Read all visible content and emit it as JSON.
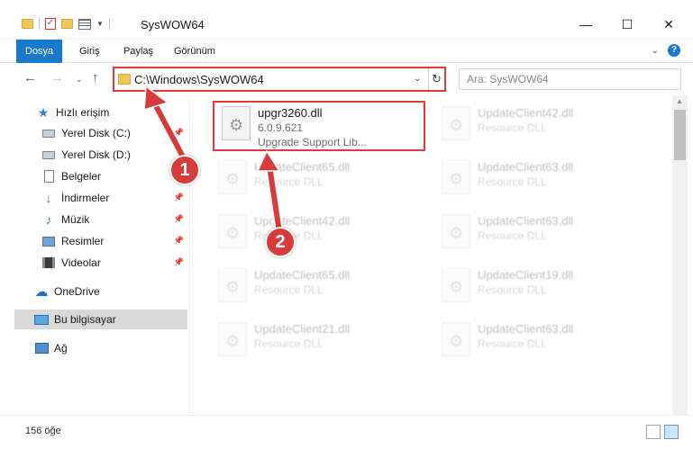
{
  "window": {
    "title": "SysWOW64",
    "minimize": "—",
    "maximize": "☐",
    "close": "✕"
  },
  "ribbon": {
    "tabs": [
      {
        "label": "Dosya",
        "active": true
      },
      {
        "label": "Giriş",
        "active": false
      },
      {
        "label": "Paylaş",
        "active": false
      },
      {
        "label": "Görünüm",
        "active": false
      }
    ]
  },
  "address": {
    "path": "C:\\Windows\\SysWOW64",
    "search_placeholder": "Ara: SysWOW64"
  },
  "sidebar": {
    "items": [
      {
        "label": "Hızlı erişim",
        "icon": "star-icon",
        "pinned": false
      },
      {
        "label": "Yerel Disk (C:)",
        "icon": "drive-icon",
        "pinned": true
      },
      {
        "label": "Yerel Disk (D:)",
        "icon": "drive-icon",
        "pinned": false
      },
      {
        "label": "Belgeler",
        "icon": "document-icon",
        "pinned": true
      },
      {
        "label": "İndirmeler",
        "icon": "download-icon",
        "pinned": true
      },
      {
        "label": "Müzik",
        "icon": "music-icon",
        "pinned": true
      },
      {
        "label": "Resimler",
        "icon": "pictures-icon",
        "pinned": true
      },
      {
        "label": "Videolar",
        "icon": "video-icon",
        "pinned": true
      },
      {
        "label": "OneDrive",
        "icon": "cloud-icon",
        "pinned": false
      },
      {
        "label": "Bu bilgisayar",
        "icon": "computer-icon",
        "pinned": false,
        "selected": true
      },
      {
        "label": "Ağ",
        "icon": "network-icon",
        "pinned": false
      }
    ]
  },
  "files": {
    "highlighted": {
      "name": "upgr3260.dll",
      "version": "6.0.9.621",
      "description": "Upgrade Support Lib..."
    },
    "faded": [
      {
        "name": "UpdateClient42.dll",
        "type": "Resource DLL"
      },
      {
        "name": "UpdateClient65.dll",
        "type": "Resource DLL"
      },
      {
        "name": "UpdateClient63.dll",
        "type": "Resource DLL"
      },
      {
        "name": "UpdateClient42.dll",
        "type": "Resource DLL"
      },
      {
        "name": "UpdateClient63.dll",
        "type": "Resource DLL"
      },
      {
        "name": "UpdateClient65.dll",
        "type": "Resource DLL"
      },
      {
        "name": "UpdateClient19.dll",
        "type": "Resource DLL"
      },
      {
        "name": "UpdateClient21.dll",
        "type": "Resource DLL"
      },
      {
        "name": "UpdateClient63.dll",
        "type": "Resource DLL"
      }
    ]
  },
  "status": {
    "item_count": "156 öğe"
  },
  "callouts": {
    "one": "1",
    "two": "2"
  },
  "colors": {
    "accent": "#1979ca",
    "annotation": "#d83b3b"
  }
}
